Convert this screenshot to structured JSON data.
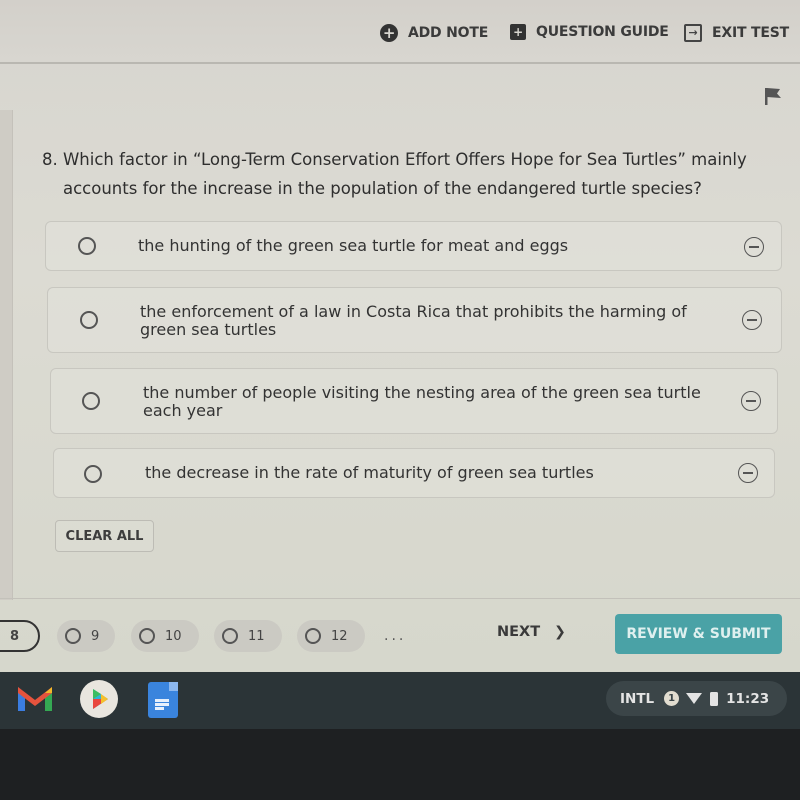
{
  "topbar": {
    "add_note": "ADD NOTE",
    "question_guide": "QUESTION GUIDE",
    "exit_test": "EXIT TEST"
  },
  "question": {
    "number": "8.",
    "line1": "8. Which factor in “Long-Term Conservation Effort Offers Hope for Sea Turtles” mainly",
    "line2": "accounts for the increase in the population of the endangered turtle species?",
    "flag_icon": "flag-icon"
  },
  "options": [
    {
      "text": "the hunting of the green sea turtle for meat and eggs",
      "selected": false
    },
    {
      "text": "the enforcement of a law in Costa Rica that prohibits the harming of green sea turtles",
      "selected": false
    },
    {
      "text": "the number of people visiting the nesting area of the green sea turtle each year",
      "selected": false
    },
    {
      "text": "the decrease in the rate of maturity of green sea turtles",
      "selected": false
    }
  ],
  "clear_all": "CLEAR ALL",
  "navigation": {
    "current": "8",
    "questions": [
      "9",
      "10",
      "11",
      "12"
    ],
    "ellipsis": "...",
    "next": "NEXT",
    "next_chevron": "❯",
    "review_submit": "REVIEW & SUBMIT"
  },
  "shelf": {
    "apps": [
      "gmail",
      "play-store",
      "google-docs"
    ],
    "tray": {
      "input_method": "INTL",
      "notifications": "1",
      "time": "11:23"
    }
  },
  "colors": {
    "accent": "#4aa2a6",
    "shelf": "#2b3437"
  }
}
